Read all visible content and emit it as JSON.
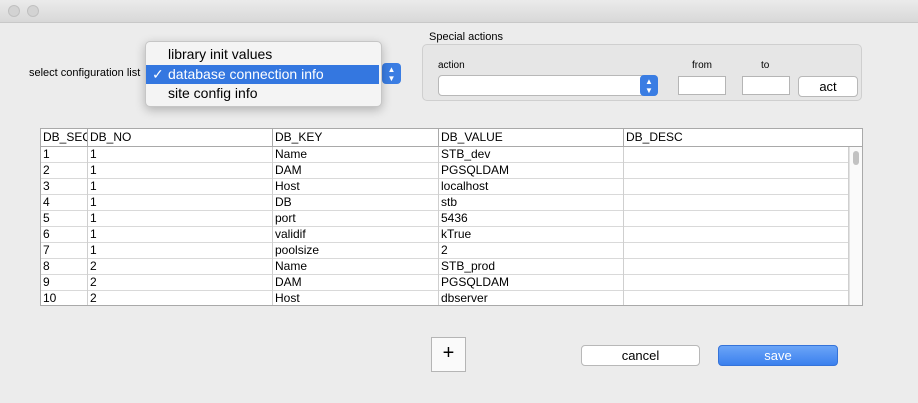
{
  "config": {
    "label": "select configuration list",
    "options": [
      "library init values",
      "database connection info",
      "site config info"
    ],
    "selected_index": 1,
    "check_glyph": "✓"
  },
  "special": {
    "title": "Special actions",
    "action_label": "action",
    "action_value": "",
    "from_label": "from",
    "from_value": "",
    "to_label": "to",
    "to_value": "",
    "act_label": "act"
  },
  "table": {
    "columns": [
      "DB_SEQ",
      "DB_NO",
      "DB_KEY",
      "DB_VALUE",
      "DB_DESC"
    ],
    "rows": [
      [
        "1",
        "1",
        "Name",
        "STB_dev",
        ""
      ],
      [
        "2",
        "1",
        "DAM",
        "PGSQLDAM",
        ""
      ],
      [
        "3",
        "1",
        "Host",
        "localhost",
        ""
      ],
      [
        "4",
        "1",
        "DB",
        "stb",
        ""
      ],
      [
        "5",
        "1",
        "port",
        "5436",
        ""
      ],
      [
        "6",
        "1",
        "validif",
        "kTrue",
        ""
      ],
      [
        "7",
        "1",
        "poolsize",
        "2",
        ""
      ],
      [
        "8",
        "2",
        "Name",
        "STB_prod",
        ""
      ],
      [
        "9",
        "2",
        "DAM",
        "PGSQLDAM",
        ""
      ],
      [
        "10",
        "2",
        "Host",
        "dbserver",
        ""
      ]
    ]
  },
  "buttons": {
    "add": "+",
    "cancel": "cancel",
    "save": "save"
  },
  "colors": {
    "accent": "#3477e0",
    "window_bg": "#ececec"
  }
}
